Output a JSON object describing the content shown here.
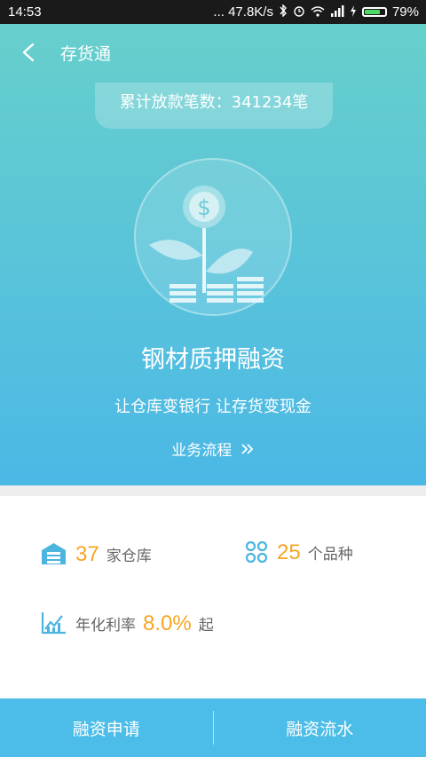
{
  "status_bar": {
    "time": "14:53",
    "network_speed": "... 47.8K/s",
    "battery": "79%",
    "battery_level": 0.79,
    "icons": [
      "bluetooth-icon",
      "alarm-icon",
      "wifi-icon",
      "signal-icon",
      "charging-icon",
      "battery-icon"
    ]
  },
  "header": {
    "title": "存货通",
    "back_icon": "chevron-left-icon"
  },
  "hero": {
    "loan_count": "累计放款笔数：341234笔",
    "emblem_icon": "money-plant-icon",
    "product_title": "钢材质押融资",
    "slogan": "让仓库变银行 让存货变现金",
    "process_link": "业务流程",
    "process_icon": "double-chevron-right-icon"
  },
  "stats": {
    "warehouses": {
      "value": "37",
      "unit": "家仓库",
      "icon": "warehouse-icon"
    },
    "varieties": {
      "value": "25",
      "unit": "个品种",
      "icon": "category-grid-icon"
    },
    "rate": {
      "label": "年化利率",
      "value": "8.0%",
      "unit": "起",
      "icon": "trend-chart-icon"
    }
  },
  "bottom_bar": {
    "apply": "融资申请",
    "records": "融资流水"
  },
  "colors": {
    "accent_orange": "#f6a623",
    "accent_blue": "#4cbde8",
    "hero_top": "#67cfcb"
  }
}
